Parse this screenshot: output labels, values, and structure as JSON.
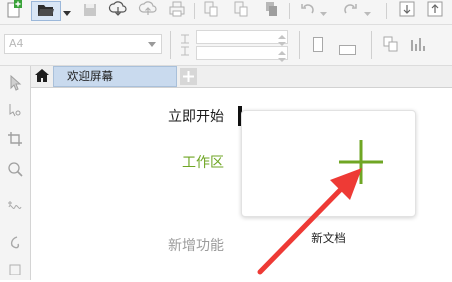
{
  "colors": {
    "accent_green": "#6fa624",
    "annotation_red": "#ee3a35",
    "tab_active": "#c9daee",
    "nav_active_bar": "#111111"
  },
  "toolbar": {
    "icons": [
      "new-document-icon",
      "open-folder-icon",
      "dropdown-arrow-icon",
      "save-icon",
      "cloud-download-icon",
      "cloud-upload-icon",
      "print-icon",
      "import-icon",
      "export-icon",
      "publish-icon",
      "undo-icon",
      "redo-icon",
      "zoom-in-icon",
      "zoom-out-icon"
    ]
  },
  "propbar": {
    "paper_size": "A4"
  },
  "tabs": {
    "welcome_label": "欢迎屏幕"
  },
  "welcome": {
    "nav_start": "立即开始",
    "nav_workspace": "工作区",
    "nav_new_features": "新增功能",
    "new_document_label": "新文档"
  }
}
